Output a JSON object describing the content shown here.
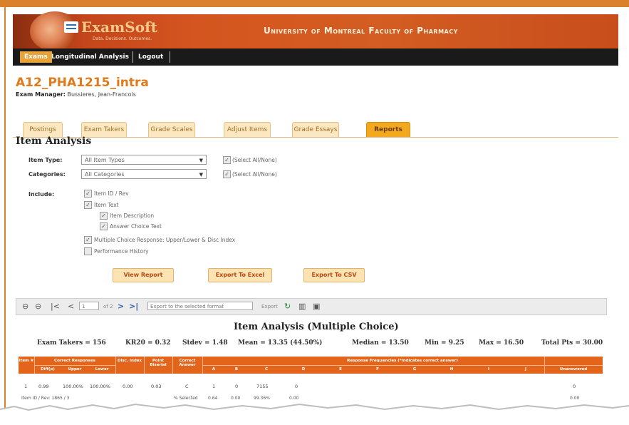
{
  "colors": {
    "brand_orange": "#d9822b",
    "header_red": "#c4461c",
    "tab_active": "#f3a91d",
    "table_head": "#e2651b"
  },
  "header": {
    "logo_text": "ExamSoft",
    "logo_tagline": "Data. Decisions. Outcomes.",
    "university": "University of Montreal Faculty of Pharmacy"
  },
  "nav": {
    "items": [
      "Exams",
      "Longitudinal Analysis",
      "Logout"
    ]
  },
  "exam": {
    "title": "A12_PHA1215_intra",
    "manager_label": "Exam Manager:",
    "manager_name": "Bussieres, Jean-Francois"
  },
  "tabs": [
    "Postings",
    "Exam Takers",
    "Grade Scales",
    "Adjust Items",
    "Grade Essays",
    "Reports"
  ],
  "active_tab": "Reports",
  "item_analysis": {
    "title": "Item Analysis",
    "item_type_label": "Item Type:",
    "item_type_value": "All Item Types",
    "categories_label": "Categories:",
    "categories_value": "All Categories",
    "select_all": "(Select All/None)",
    "include_label": "Include:",
    "options": [
      {
        "label": "Item ID / Rev",
        "checked": true
      },
      {
        "label": "Item Text",
        "checked": true
      },
      {
        "label": "Item Description",
        "checked": true
      },
      {
        "label": "Answer Choice Text",
        "checked": true
      },
      {
        "label": "Multiple Choice Response: Upper/Lower & Disc Index",
        "checked": true
      },
      {
        "label": "Performance History",
        "checked": false
      }
    ],
    "buttons": [
      "View Report",
      "Export To Excel",
      "Export To CSV"
    ]
  },
  "toolbar": {
    "page_value": "1",
    "page_of": "of 2",
    "export_select": "Export to the selected format",
    "export_label": "Export"
  },
  "report": {
    "title": "Item Analysis (Multiple Choice)",
    "stats": [
      "Exam Takers = 156",
      "KR20 = 0.32",
      "Stdev = 1.48",
      "Mean = 13.35 (44.50%)",
      "Median = 13.50",
      "Min = 9.25",
      "Max = 16.50",
      "Total Pts = 30.00"
    ],
    "header": {
      "item": "Item #",
      "correct_responses": "Correct Responses",
      "diff": "Diff(p)",
      "upper": "Upper",
      "lower": "Lower",
      "disc_index": "Disc. Index",
      "point_biserial": "Point Biserial",
      "correct_answer": "Correct Answer",
      "response_frequencies": "Response Frequencies (*Indicates correct answer)",
      "choices": [
        "A",
        "B",
        "C",
        "D",
        "E",
        "F",
        "G",
        "H",
        "I",
        "J"
      ],
      "unanswered": "Unanswered"
    },
    "row1": {
      "item": "1",
      "diff": "0.99",
      "upper": "100.00%",
      "lower": "100.00%",
      "disc": "0.00",
      "pb": "0.03",
      "correct": "C",
      "a": "1",
      "b": "0",
      "c": "7155",
      "d": "0",
      "unanswered": "0"
    },
    "row2": {
      "id": "Item ID / Rev: 1865 / 3",
      "selected": "% Selected",
      "a": "0.64",
      "b": "0.00",
      "c": "99.36%",
      "d": "0.00",
      "unanswered": "0.00"
    }
  }
}
